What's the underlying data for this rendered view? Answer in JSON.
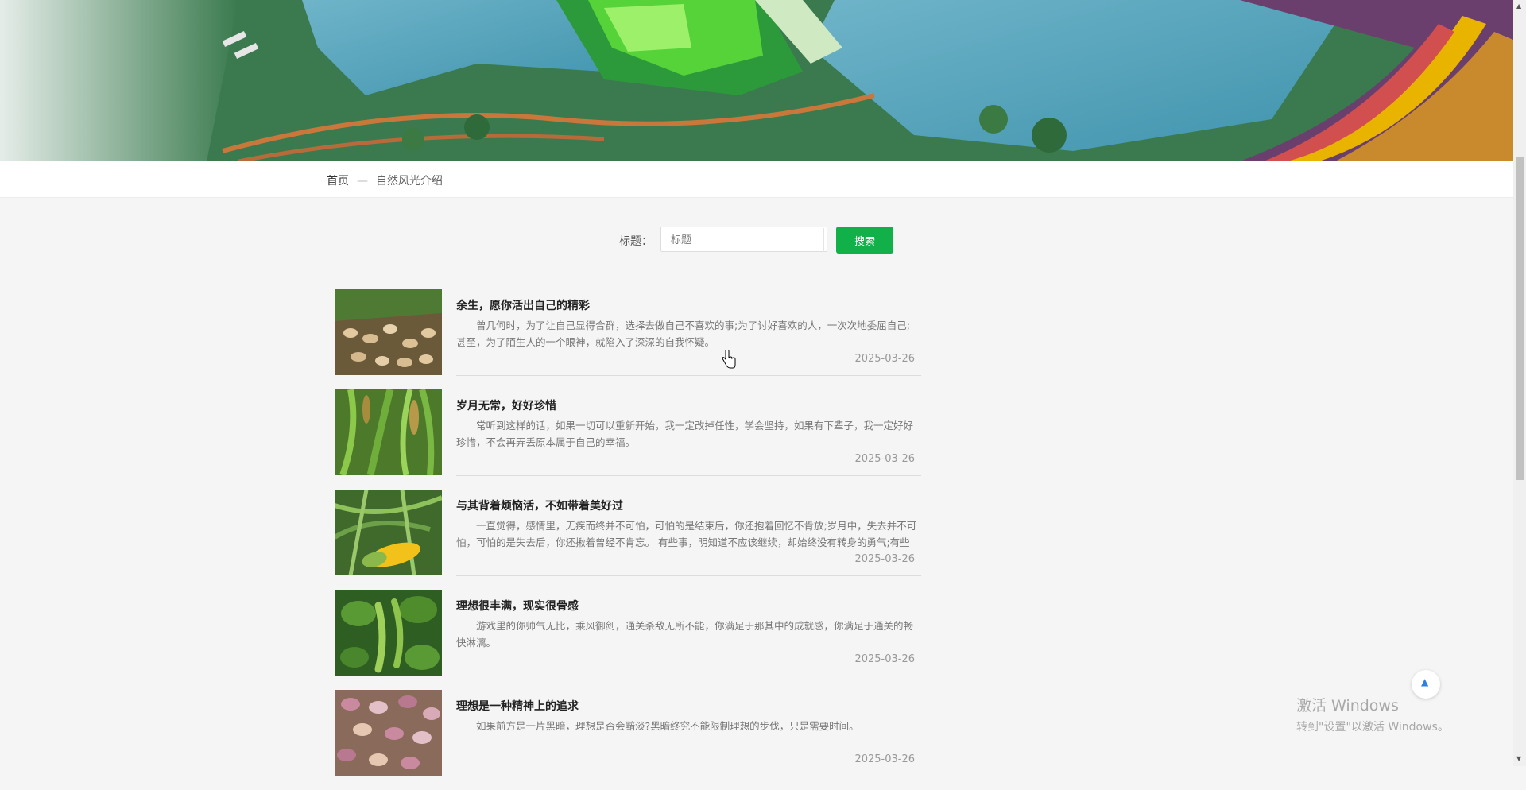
{
  "breadcrumb": {
    "home": "首页",
    "separator": "—",
    "current": "自然风光介绍"
  },
  "search": {
    "label": "标题：",
    "placeholder": "标题",
    "button": "搜索"
  },
  "articles": [
    {
      "title": "余生，愿你活出自己的精彩",
      "summary": "曾几何时，为了让自己显得合群，选择去做自己不喜欢的事;为了讨好喜欢的人，一次次地委屈自己;甚至，为了陌生人的一个眼神，就陷入了深深的自我怀疑。",
      "date": "2025-03-26",
      "image": "peanuts"
    },
    {
      "title": "岁月无常，好好珍惜",
      "summary": "常听到这样的话，如果一切可以重新开始，我一定改掉任性，学会坚持，如果有下辈子，我一定好好珍惜，不会再弄丢原本属于自己的幸福。",
      "date": "2025-03-26",
      "image": "millet"
    },
    {
      "title": "与其背着烦恼活，不如带着美好过",
      "summary": "一直觉得，感情里，无疾而终并不可怕，可怕的是结束后，你还抱着回忆不肯放;岁月中，失去并不可怕，可怕的是失去后，你还揪着曾经不肯忘。 有些事，明知道不应该继续，却始终没有转身的勇气;有些",
      "date": "2025-03-26",
      "image": "corn"
    },
    {
      "title": "理想很丰满，现实很骨感",
      "summary": "游戏里的你帅气无比，乘风御剑，通关杀敌无所不能，你满足于那其中的成就感，你满足于通关的畅快淋漓。",
      "date": "2025-03-26",
      "image": "peas"
    },
    {
      "title": "理想是一种精神上的追求",
      "summary": "如果前方是一片黑暗，理想是否会黯淡?黑暗终究不能限制理想的步伐，只是需要时间。",
      "date": "2025-03-26",
      "image": "beans"
    }
  ],
  "back_to_top_icon": "arrow-up-icon",
  "watermark": {
    "line1": "激活 Windows",
    "line2": "转到\"设置\"以激活 Windows。"
  },
  "colors": {
    "accent": "#12b048",
    "background": "#f5f5f5"
  }
}
